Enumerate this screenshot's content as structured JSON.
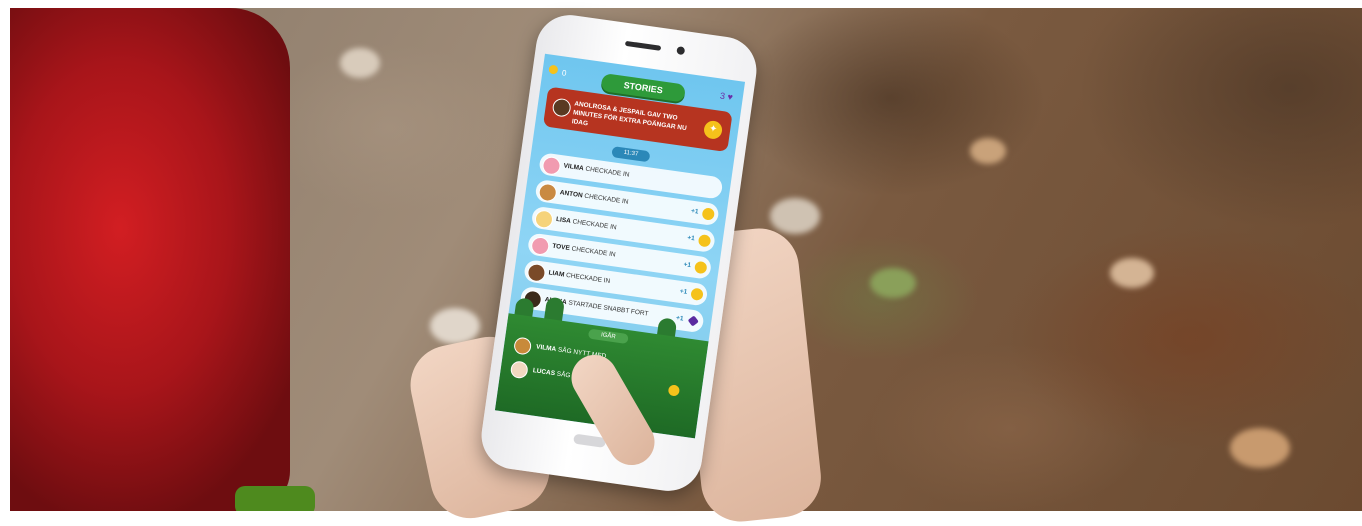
{
  "app": {
    "coins": "0",
    "title": "STORIES",
    "gems": "3"
  },
  "banner": {
    "text": "ANOLROSA & JESPAIL GAV TWO MINUTES FÖR EXTRA POÄNGAR NU IDAG"
  },
  "feed": {
    "time": "11:37",
    "rows": [
      {
        "name": "VILMA",
        "action": "CHECKADE IN",
        "points": "",
        "avatar_color": "#f19bb0"
      },
      {
        "name": "ANTON",
        "action": "CHECKADE IN",
        "points": "+1",
        "avatar_color": "#c98a42"
      },
      {
        "name": "LISA",
        "action": "CHECKADE IN",
        "points": "+1",
        "avatar_color": "#f6d37a"
      },
      {
        "name": "TOVE",
        "action": "CHECKADE IN",
        "points": "+1",
        "avatar_color": "#f19bb0"
      },
      {
        "name": "LIAM",
        "action": "CHECKADE IN",
        "points": "+1",
        "avatar_color": "#7a4a28"
      },
      {
        "name": "ALEXA",
        "action": "STARTADE SNABBT FORT",
        "points": "+1",
        "avatar_color": "#3a2a1a"
      }
    ]
  },
  "yesterday": {
    "label": "IGÅR",
    "rows": [
      {
        "name": "VILMA",
        "action": "SÅG NYTT MED"
      },
      {
        "name": "LUCAS",
        "action": "SÅG NYTT MED"
      }
    ]
  },
  "colors": {
    "sky": "#8fd5f5",
    "banner": "#b63420",
    "pill_green": "#2e9a3a",
    "coin": "#f5c21b",
    "hat_red": "#c81b20"
  }
}
